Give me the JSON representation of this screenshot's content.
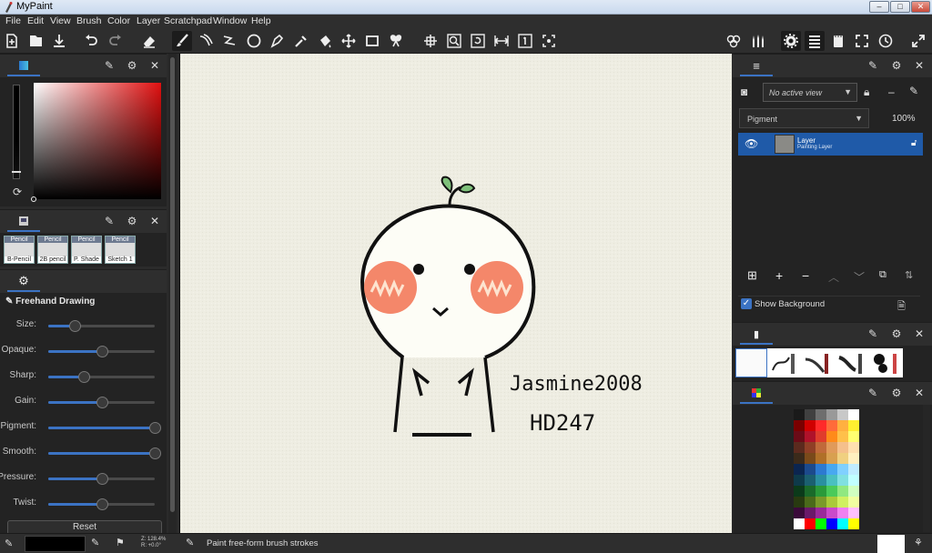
{
  "window": {
    "title": "MyPaint",
    "min": "–",
    "max": "□",
    "close": "✕"
  },
  "menu": [
    "File",
    "Edit",
    "View",
    "Brush",
    "Color",
    "Layer",
    "Scratchpad",
    "Window",
    "Help"
  ],
  "left": {
    "brush_thumbs": [
      {
        "top": "Pencil",
        "name": "B-Pencil"
      },
      {
        "top": "Pencil",
        "name": "2B pencil"
      },
      {
        "top": "Pencil",
        "name": "P. Shade"
      },
      {
        "top": "Pencil",
        "name": "Sketch 1"
      }
    ],
    "tool_options_title": "Freehand Drawing",
    "sliders": [
      {
        "label": "Size:",
        "value": 0.25
      },
      {
        "label": "Opaque:",
        "value": 0.5
      },
      {
        "label": "Sharp:",
        "value": 0.33
      },
      {
        "label": "Gain:",
        "value": 0.5
      },
      {
        "label": "Pigment:",
        "value": 1.0
      },
      {
        "label": "Smooth:",
        "value": 1.0
      },
      {
        "label": "Pressure:",
        "value": 0.5
      },
      {
        "label": "Twist:",
        "value": 0.5
      }
    ],
    "reset_label": "Reset"
  },
  "right": {
    "view_select": "No active view",
    "mode_select": "Pigment",
    "opacity": "100%",
    "layer_name": "Layer",
    "layer_type": "Painting Layer",
    "show_background": "Show Background"
  },
  "canvas": {
    "text1": "Jasmine2008",
    "text2": "HD247"
  },
  "status": {
    "zoom": "Z: 128.4%",
    "rotation": "R: +0.0°",
    "message": "Paint free-form brush strokes"
  },
  "palette_colors": [
    [
      "#1a1a1a",
      "#404040",
      "#6e6e6e",
      "#999999",
      "#c8c8c8",
      "#ffffff"
    ],
    [
      "#7a0000",
      "#d00000",
      "#ff2a2a",
      "#ff6b3a",
      "#ffb040",
      "#fff030"
    ],
    [
      "#6b0b17",
      "#b0122a",
      "#e03c2c",
      "#ff8a1a",
      "#ffc04a",
      "#ffff70"
    ],
    [
      "#5b2a1e",
      "#8f3f26",
      "#c06a3a",
      "#e09a5a",
      "#f5c08c",
      "#ffe0b0"
    ],
    [
      "#3b2a1a",
      "#7a4a1a",
      "#b07028",
      "#d8a050",
      "#f0d080",
      "#fff0c0"
    ],
    [
      "#0b2550",
      "#1c4a8c",
      "#2d7ad0",
      "#48a8f0",
      "#80d0ff",
      "#c0ecff"
    ],
    [
      "#0e3a4a",
      "#1b6070",
      "#2a90a0",
      "#4ac0c0",
      "#80e0e0",
      "#c0ffff"
    ],
    [
      "#0b3a1a",
      "#1a6a2a",
      "#2a9a3a",
      "#4aca5a",
      "#90e880",
      "#d0ffc0"
    ],
    [
      "#283a10",
      "#4a6a1a",
      "#7a9a2a",
      "#aaca3a",
      "#d0f060",
      "#f0ffa0"
    ],
    [
      "#3a0a3a",
      "#6a1a6a",
      "#9a2a9a",
      "#ca4aca",
      "#f080f0",
      "#ffc0ff"
    ],
    [
      "#ffffff",
      "#ff0000",
      "#00ff00",
      "#0000ff",
      "#00ffff",
      "#ffff00"
    ]
  ]
}
